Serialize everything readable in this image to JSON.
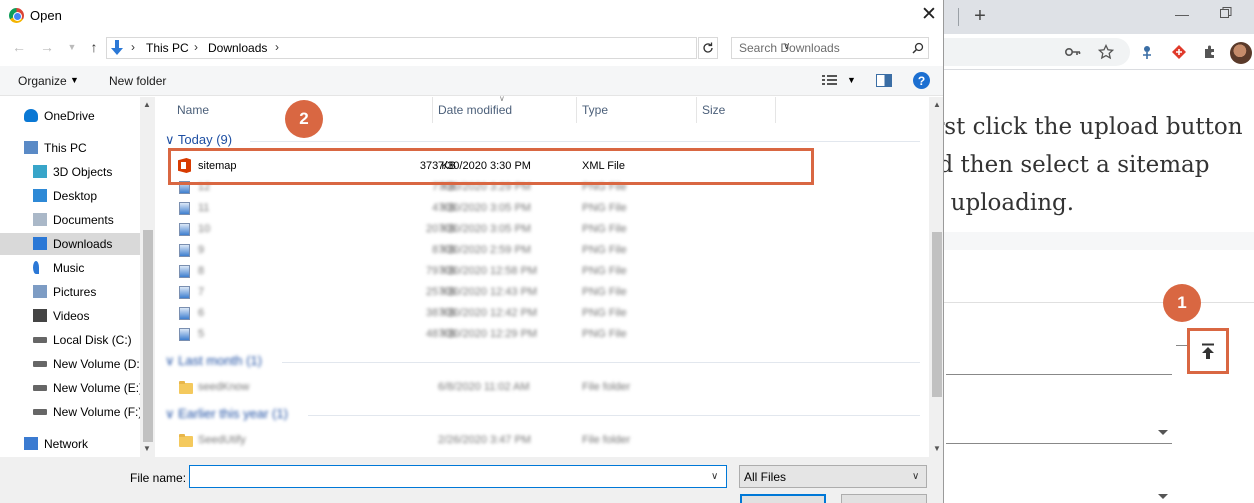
{
  "dialog": {
    "title": "Open",
    "breadcrumb": [
      "This PC",
      "Downloads"
    ],
    "search_placeholder": "Search Downloads",
    "organize_label": "Organize",
    "new_folder_label": "New folder",
    "columns": {
      "name": "Name",
      "date": "Date modified",
      "type": "Type",
      "size": "Size"
    },
    "sidebar": [
      {
        "label": "OneDrive",
        "icon": "cloud-icon"
      },
      {
        "label": "This PC",
        "icon": "computer-icon"
      },
      {
        "label": "3D Objects",
        "icon": "cube-icon"
      },
      {
        "label": "Desktop",
        "icon": "desktop-icon"
      },
      {
        "label": "Documents",
        "icon": "document-icon"
      },
      {
        "label": "Downloads",
        "icon": "download-icon"
      },
      {
        "label": "Music",
        "icon": "music-icon"
      },
      {
        "label": "Pictures",
        "icon": "pictures-icon"
      },
      {
        "label": "Videos",
        "icon": "video-icon"
      },
      {
        "label": "Local Disk (C:)",
        "icon": "drive-icon"
      },
      {
        "label": "New Volume (D:",
        "icon": "drive-icon"
      },
      {
        "label": "New Volume (E:)",
        "icon": "drive-icon"
      },
      {
        "label": "New Volume (F:)",
        "icon": "drive-icon"
      },
      {
        "label": "Network",
        "icon": "network-icon"
      }
    ],
    "groups": {
      "today": "Today (9)",
      "last_month": "Last month (1)",
      "earlier": "Earlier this year (1)"
    },
    "files_today": [
      {
        "name": "sitemap",
        "date": "7/30/2020 3:30 PM",
        "type": "XML File",
        "size": "373 KB"
      },
      {
        "name": "12",
        "date": "7/30/2020 3:29 PM",
        "type": "PNG File",
        "size": "7 KB"
      },
      {
        "name": "11",
        "date": "7/30/2020 3:05 PM",
        "type": "PNG File",
        "size": "4 KB"
      },
      {
        "name": "10",
        "date": "7/30/2020 3:05 PM",
        "type": "PNG File",
        "size": "20 KB"
      },
      {
        "name": "9",
        "date": "7/30/2020 2:59 PM",
        "type": "PNG File",
        "size": "8 KB"
      },
      {
        "name": "8",
        "date": "7/30/2020 12:58 PM",
        "type": "PNG File",
        "size": "79 KB"
      },
      {
        "name": "7",
        "date": "7/30/2020 12:43 PM",
        "type": "PNG File",
        "size": "25 KB"
      },
      {
        "name": "6",
        "date": "7/30/2020 12:42 PM",
        "type": "PNG File",
        "size": "38 KB"
      },
      {
        "name": "5",
        "date": "7/30/2020 12:29 PM",
        "type": "PNG File",
        "size": "48 KB"
      }
    ],
    "files_last_month": [
      {
        "name": "seedKnow",
        "date": "6/8/2020 11:02 AM",
        "type": "File folder"
      }
    ],
    "files_earlier": [
      {
        "name": "SeedUtify",
        "date": "2/26/2020 3:47 PM",
        "type": "File folder"
      }
    ],
    "filename_label": "File name:",
    "filename_value": "",
    "filter_value": "All Files"
  },
  "annotations": {
    "instruction": "First click the upload button\nand then select a sitemap\nfor uploading.",
    "step1": "1",
    "step2": "2",
    "accent_color": "#d96742"
  }
}
